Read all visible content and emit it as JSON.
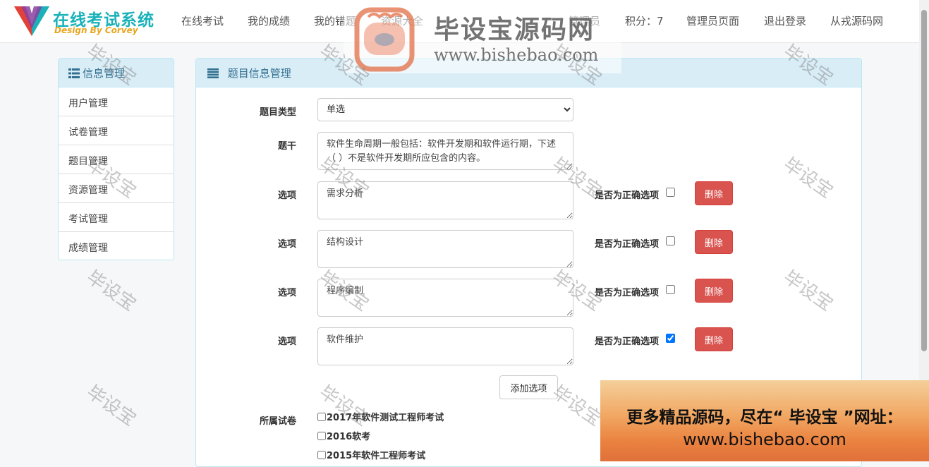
{
  "brand": {
    "title": "在线考试系统",
    "subtitle": "Design By Corvey"
  },
  "nav": {
    "items": [
      "在线考试",
      "我的成绩",
      "我的错题",
      "资源大全",
      "管理员",
      "积分：7",
      "管理员页面",
      "退出登录",
      "从戎源码网"
    ]
  },
  "sidebar": {
    "title": "信息管理",
    "items": [
      "用户管理",
      "试卷管理",
      "题目管理",
      "资源管理",
      "考试管理",
      "成绩管理"
    ]
  },
  "main": {
    "title": "题目信息管理",
    "type_label": "题目类型",
    "type_value": "单选",
    "stem_label": "题干",
    "stem_text": "软件生命周期一般包括：软件开发期和软件运行期，下述（ ）不是软件开发期所应包含的内容。",
    "option_label": "选项",
    "correct_label": "是否为正确选项",
    "delete_label": "删除",
    "options": [
      {
        "text": "需求分析",
        "correct": false
      },
      {
        "text": "结构设计",
        "correct": false
      },
      {
        "text": "程序编制",
        "correct": false
      },
      {
        "text": "软件维护",
        "correct": true
      }
    ],
    "add_option_label": "添加选项",
    "paper_label": "所属试卷",
    "papers": [
      "2017年软件测试工程师考试",
      "2016软考",
      "2015年软件工程师考试"
    ]
  },
  "watermark": {
    "text": "毕设宝",
    "center_title": "毕设宝源码网",
    "center_url": "www.bishebao.com"
  },
  "banner": {
    "line1": "更多精品源码，尽在“ 毕设宝 ”网址：",
    "line2": "www.bishebao.com"
  },
  "colors": {
    "panel_heading_bg": "#d9edf7",
    "panel_heading_text": "#31708f",
    "danger": "#d9534f",
    "brand_teal": "#19b2b9",
    "brand_orange": "#e8a51e"
  }
}
